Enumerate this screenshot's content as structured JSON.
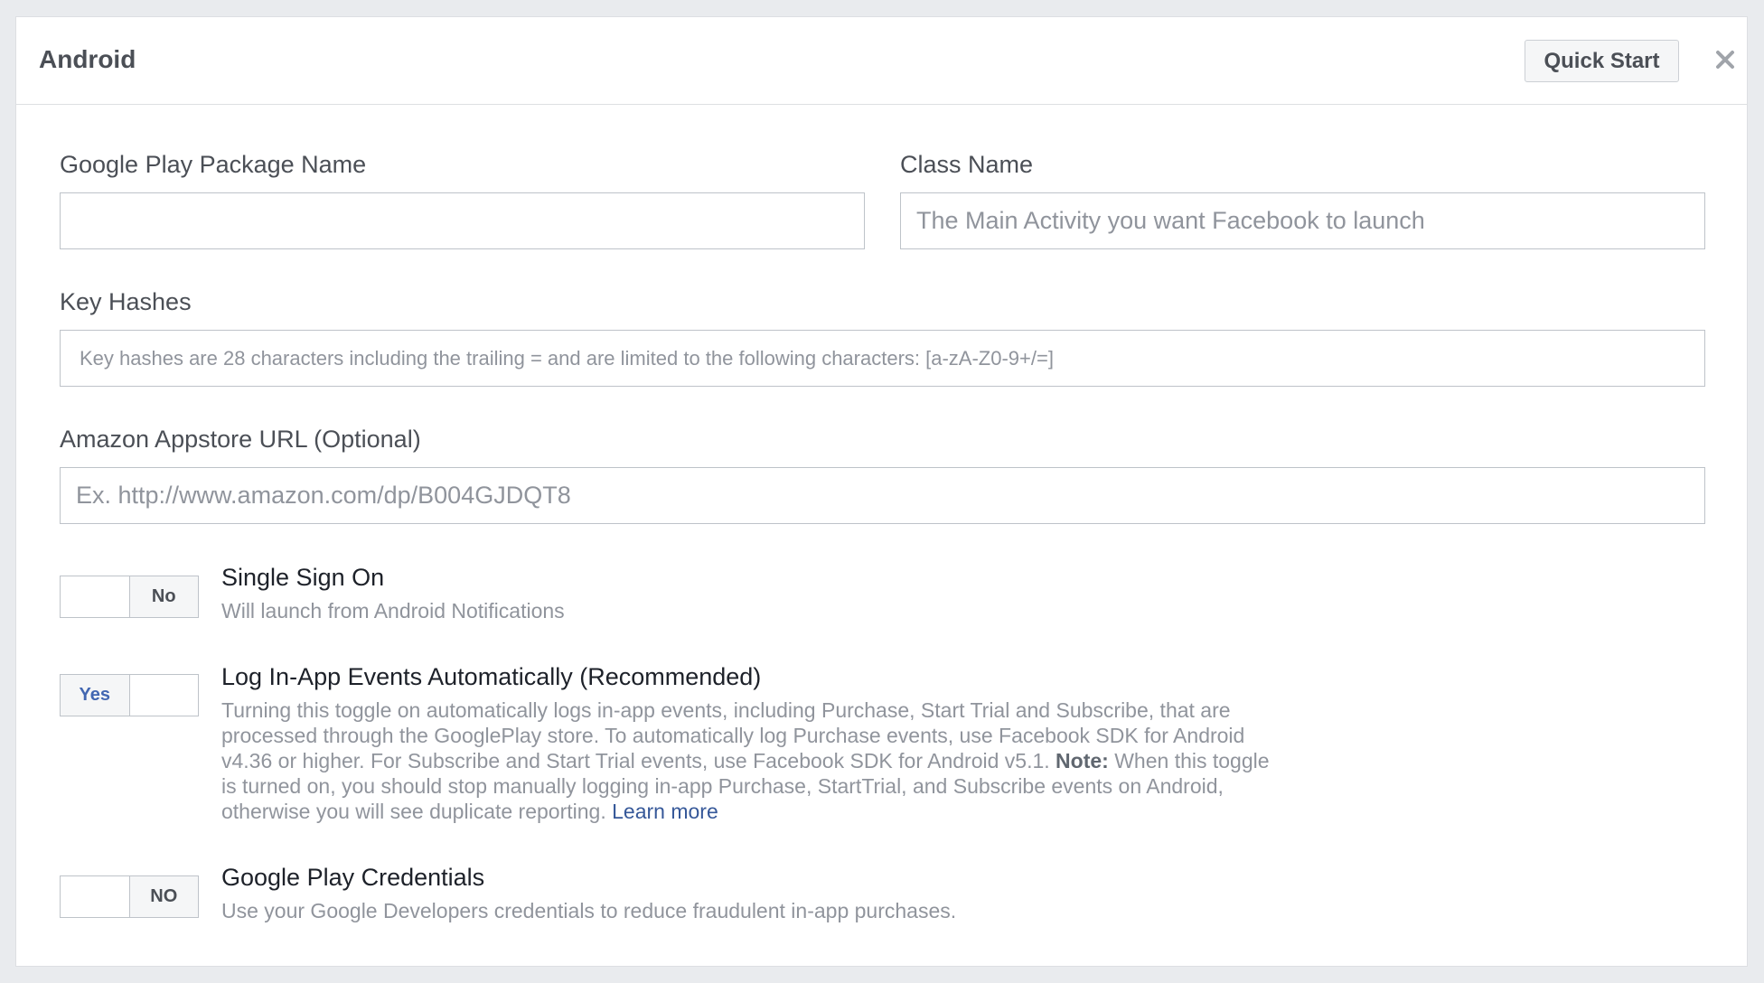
{
  "header": {
    "title": "Android",
    "quick_start_label": "Quick Start",
    "close_icon": "close-icon"
  },
  "fields": {
    "package_name": {
      "label": "Google Play Package Name",
      "value": "",
      "placeholder": ""
    },
    "class_name": {
      "label": "Class Name",
      "value": "",
      "placeholder": "The Main Activity you want Facebook to launch"
    },
    "key_hashes": {
      "label": "Key Hashes",
      "value": "",
      "placeholder": "Key hashes are 28 characters including the trailing = and are limited to the following characters: [a-zA-Z0-9+/=]"
    },
    "amazon_url": {
      "label": "Amazon Appstore URL (Optional)",
      "value": "",
      "placeholder": "Ex. http://www.amazon.com/dp/B004GJDQT8"
    }
  },
  "options": {
    "single_sign_on": {
      "toggle_label": "No",
      "state": "off",
      "title": "Single Sign On",
      "description": "Will launch from Android Notifications"
    },
    "log_events": {
      "toggle_label": "Yes",
      "state": "on",
      "title": "Log In-App Events Automatically (Recommended)",
      "description_1": "Turning this toggle on automatically logs in-app events, including Purchase, Start Trial and Subscribe, that are processed through the GooglePlay store. To automatically log Purchase events, use Facebook SDK for Android v4.36 or higher. For Subscribe and Start Trial events, use Facebook SDK for Android v5.1.",
      "note_label": "Note:",
      "description_2": "When this toggle is turned on, you should stop manually logging in-app Purchase, StartTrial, and Subscribe events on Android, otherwise you will see duplicate reporting.",
      "learn_more": "Learn more"
    },
    "play_credentials": {
      "toggle_label": "NO",
      "state": "off",
      "title": "Google Play Credentials",
      "description": "Use your Google Developers credentials to reduce fraudulent in-app purchases."
    }
  },
  "colors": {
    "background": "#e9ebee",
    "link": "#365899",
    "toggle_on": "#4267b2"
  }
}
